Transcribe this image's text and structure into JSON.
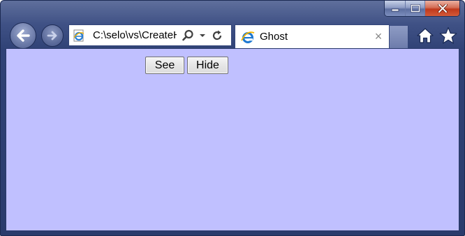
{
  "window": {
    "controls": [
      {
        "name": "minimize-icon"
      },
      {
        "name": "maximize-icon"
      },
      {
        "name": "close-icon"
      }
    ]
  },
  "nav": {
    "back_icon": "back-arrow-icon",
    "forward_icon": "forward-arrow-icon"
  },
  "address_bar": {
    "url": "C:\\selo\\vs\\CreateH",
    "favicon": "ie-page-icon",
    "search_icon": "search-icon",
    "dropdown_icon": "chevron-down-icon",
    "refresh_icon": "refresh-icon"
  },
  "tab": {
    "title": "Ghost",
    "close_label": "×",
    "favicon": "ie-logo-icon"
  },
  "toolbar": {
    "home_icon": "home-icon",
    "favorites_icon": "star-icon"
  },
  "page": {
    "background": "#c0c0ff",
    "see_label": "See",
    "hide_label": "Hide"
  }
}
